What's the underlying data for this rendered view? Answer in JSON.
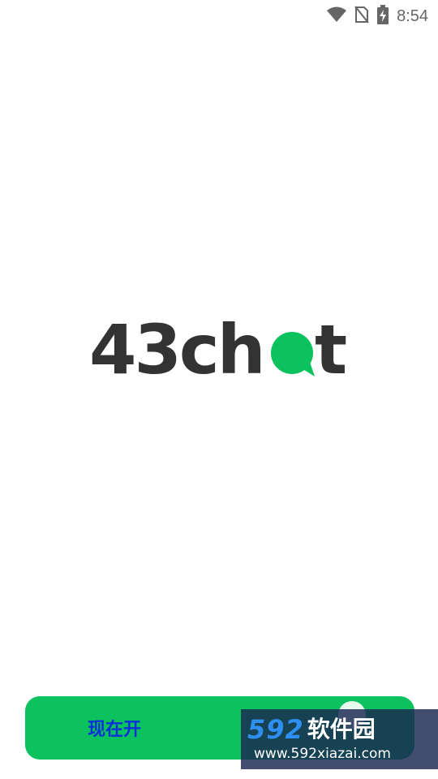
{
  "status_bar": {
    "time": "8:54",
    "icons": [
      "wifi-icon",
      "no-sim-icon",
      "battery-charging-icon"
    ]
  },
  "logo": {
    "text_prefix": "43ch",
    "text_suffix": "t",
    "bubble_letter": "a"
  },
  "start_button": {
    "label": "现在开"
  },
  "watermark": {
    "number": "592",
    "text": "软件园",
    "url": "www.592xiazai.com"
  },
  "colors": {
    "brand_green": "#0cc25f",
    "logo_dark": "#333333",
    "button_label": "#0b2fd8",
    "watermark_blue": "#2e8ff0"
  }
}
